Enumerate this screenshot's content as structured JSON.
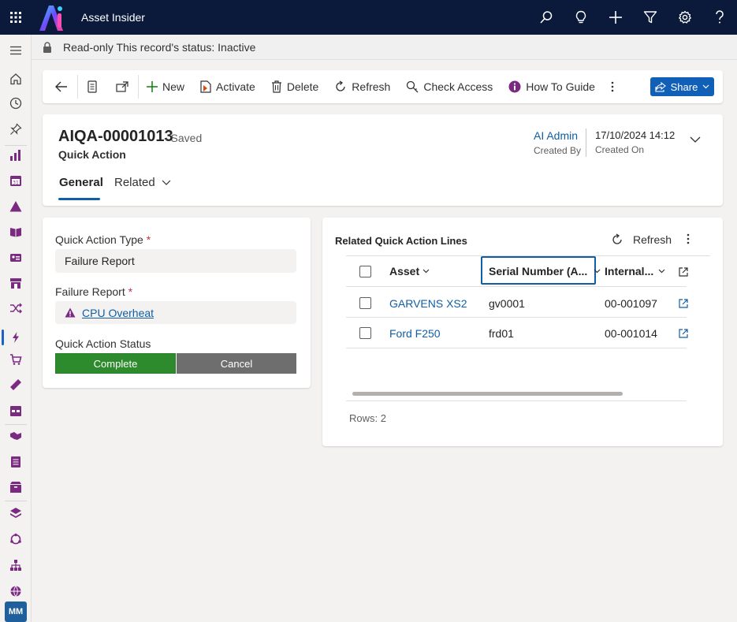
{
  "app": {
    "title": "Asset Insider",
    "brand_color": "#0b1a3b"
  },
  "top_icons": [
    "search-icon",
    "lightbulb-icon",
    "plus-icon",
    "filter-icon",
    "settings-icon",
    "help-icon"
  ],
  "notification": {
    "text": "Read-only This record's status: Inactive"
  },
  "command_bar": {
    "new_label": "New",
    "activate_label": "Activate",
    "delete_label": "Delete",
    "refresh_label": "Refresh",
    "check_access_label": "Check Access",
    "how_to_label": "How To Guide",
    "share_label": "Share"
  },
  "record": {
    "title": "AIQA-00001013",
    "saved": "- Saved",
    "entity": "Quick Action",
    "created_by_value": "AI Admin",
    "created_by_label": "Created By",
    "created_on_value": "17/10/2024 14:12",
    "created_on_label": "Created On"
  },
  "tabs": {
    "general": "General",
    "related": "Related"
  },
  "form": {
    "type_label": "Quick Action Type",
    "type_value": "Failure Report",
    "failure_label": "Failure Report",
    "failure_value": "CPU Overheat",
    "status_label": "Quick Action Status",
    "status_complete": "Complete",
    "status_cancel": "Cancel",
    "required_mark": "*"
  },
  "grid": {
    "title": "Related Quick Action Lines",
    "refresh_label": "Refresh",
    "columns": {
      "asset": "Asset",
      "serial": "Serial Number (A...",
      "internal": "Internal..."
    },
    "rows": [
      {
        "asset": "GARVENS XS2",
        "serial": "gv0001",
        "internal": "00-001097"
      },
      {
        "asset": "Ford F250",
        "serial": "frd01",
        "internal": "00-001014"
      }
    ],
    "rows_count": "Rows: 2"
  },
  "user": {
    "initials": "MM"
  }
}
